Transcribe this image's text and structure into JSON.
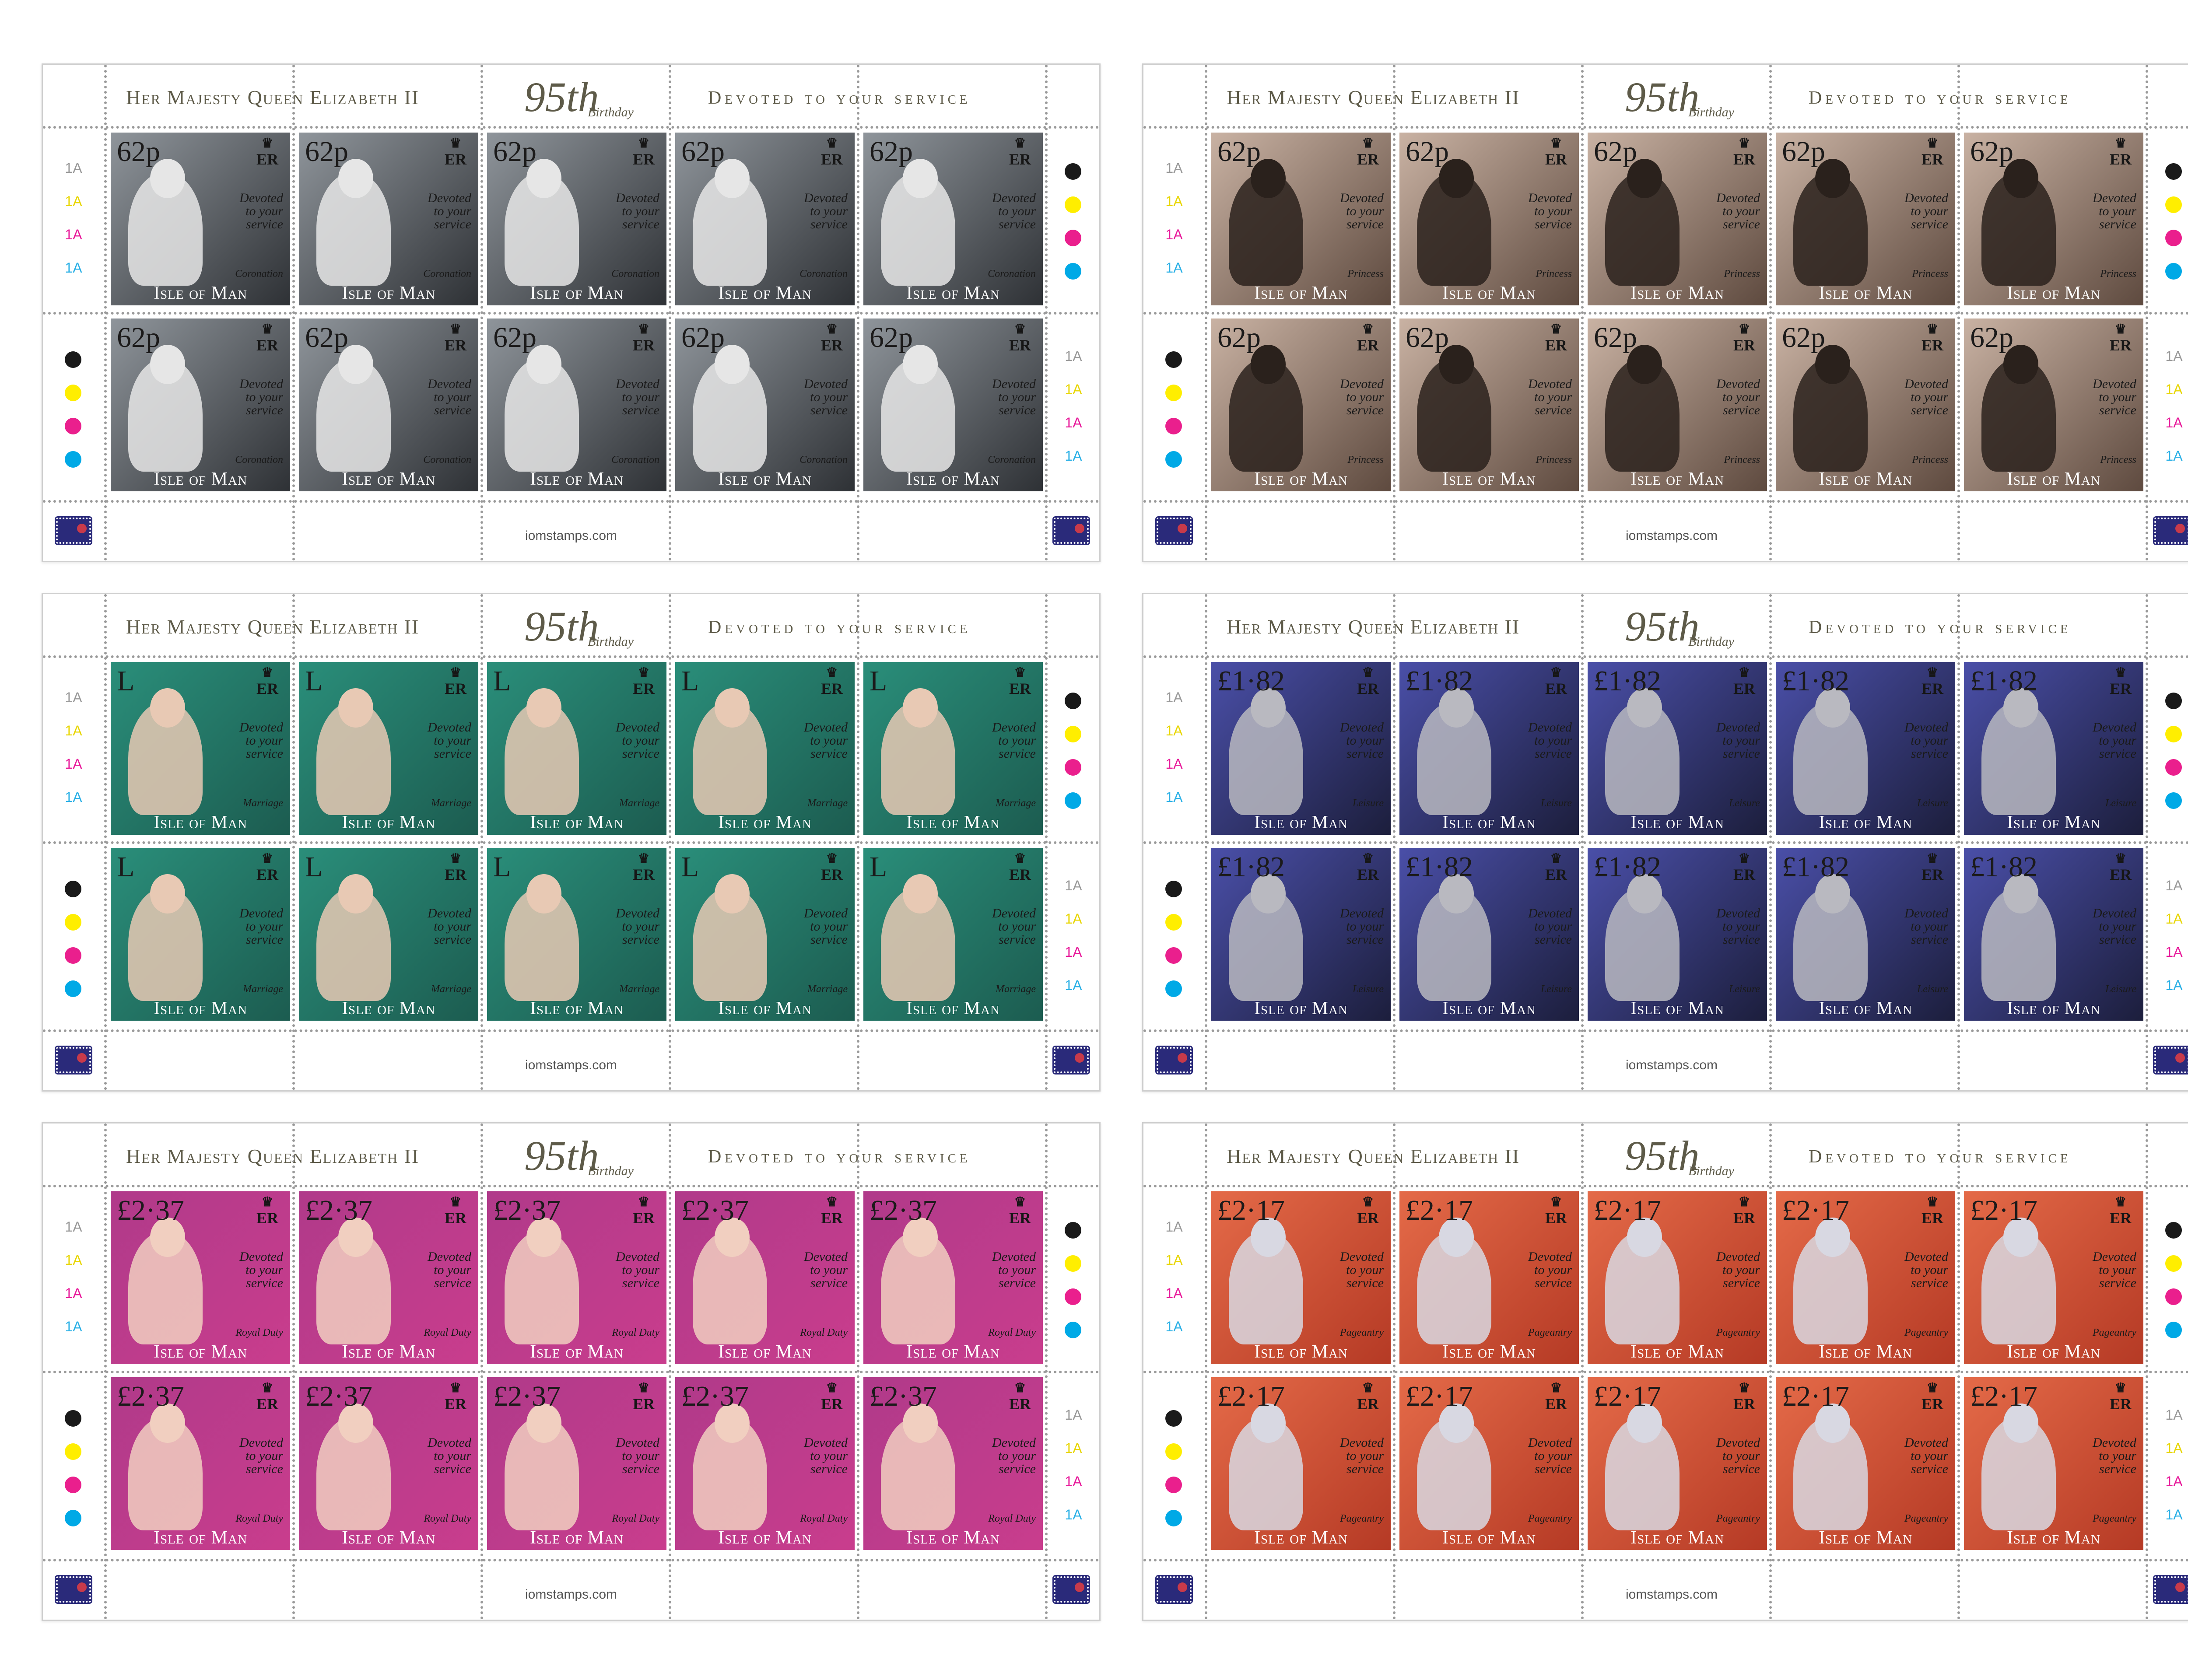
{
  "header": {
    "title": "Her Majesty Queen Elizabeth II",
    "number": "95th",
    "birthday": "Birthday",
    "motto": "Devoted to your service"
  },
  "footer_url": "iomstamps.com",
  "stamp_text": {
    "cypher": "ER",
    "crown_icon": "crown-icon",
    "motto_line1": "Devoted",
    "motto_line2": "to your",
    "motto_line3": "service",
    "country": "Isle of Man"
  },
  "registration_label": "1A",
  "registration_colors": [
    "#999999",
    "#e8d600",
    "#e8199a",
    "#2ab0e6"
  ],
  "dot_colors": [
    "#1a1a1a",
    "#ffee00",
    "#ea1f8d",
    "#00a9e6"
  ],
  "sheets": [
    {
      "value": "62p",
      "caption": "Coronation",
      "bg_top": "#8f959b",
      "bg_bottom": "#2e3135",
      "fig": "#e6e6e6"
    },
    {
      "value": "62p",
      "caption": "Princess",
      "bg_top": "#c9b2a3",
      "bg_bottom": "#5e4a3f",
      "fig": "#2a211c"
    },
    {
      "value": "L",
      "caption": "Marriage",
      "bg_top": "#2a8e7a",
      "bg_bottom": "#1c5c50",
      "fig": "#e8c9b4"
    },
    {
      "value": "£1·82",
      "caption": "Leisure",
      "bg_top": "#4a4fa8",
      "bg_bottom": "#1c1e3c",
      "fig": "#b9b9c0"
    },
    {
      "value": "£2·37",
      "caption": "Royal Duty",
      "bg_top": "#b03a8a",
      "bg_bottom": "#c93d8d",
      "fig": "#f1cfc0"
    },
    {
      "value": "£2·17",
      "caption": "Pageantry",
      "bg_top": "#e46a48",
      "bg_bottom": "#b53a25",
      "fig": "#d8d8e2"
    }
  ]
}
